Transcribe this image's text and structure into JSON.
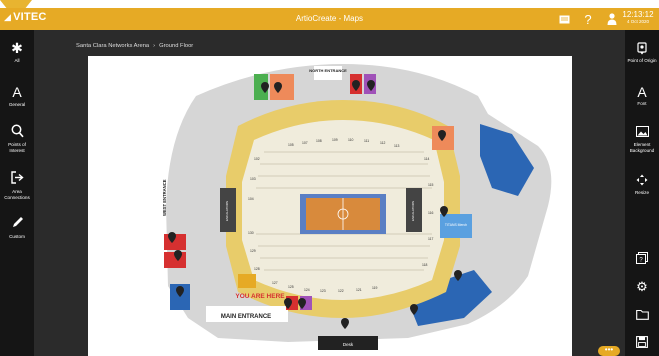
{
  "header": {
    "logo": "VITEC",
    "title": "ArtioCreate - Maps",
    "time": "12:13:12",
    "date": "4 Oct 2020"
  },
  "breadcrumb": {
    "venue": "Santa Clara Networks Arena",
    "separator": "›",
    "floor": "Ground Floor"
  },
  "left_sidebar": [
    {
      "label": "All",
      "icon": "asterisk-icon"
    },
    {
      "label": "General",
      "icon": "letter-a-icon"
    },
    {
      "label": "Points of Interest",
      "icon": "search-icon"
    },
    {
      "label": "Area Connections",
      "icon": "exit-icon"
    },
    {
      "label": "Custom",
      "icon": "pencil-icon"
    }
  ],
  "right_sidebar": [
    {
      "label": "Point of Origin",
      "icon": "pin-icon"
    },
    {
      "label": "Font",
      "icon": "letter-a-icon"
    },
    {
      "label": "Element Background",
      "icon": "image-icon"
    },
    {
      "label": "Resize",
      "icon": "resize-icon"
    }
  ],
  "right_tools": [
    "layers-icon",
    "gear-icon",
    "folder-icon",
    "save-icon"
  ],
  "map": {
    "north_entrance": "NORTH ENTRANCE",
    "west_entrance": "WEST ENTRANCE",
    "main_entrance": "MAIN ENTRANCE",
    "you_are_here": "YOU ARE HERE",
    "desk": "Desk",
    "merch": "TITANS Merch",
    "escalators": [
      "ESCALATORS",
      "ESCALATORS"
    ],
    "sections_top": [
      "105",
      "107",
      "108",
      "109",
      "110",
      "111",
      "112",
      "113"
    ],
    "sections_bottom": [
      "127",
      "125",
      "124",
      "123",
      "122",
      "121",
      "119"
    ],
    "sections_left": [
      "102",
      "103",
      "104",
      "130",
      "129",
      "128"
    ],
    "sections_right": [
      "114",
      "115",
      "116",
      "117",
      "118"
    ]
  },
  "colors": {
    "accent": "#e6aa25",
    "concourse": "#d8d8d8",
    "seating": "#e8cc6a",
    "court": "#d88a3c",
    "blue_area": "#2b66b4"
  }
}
